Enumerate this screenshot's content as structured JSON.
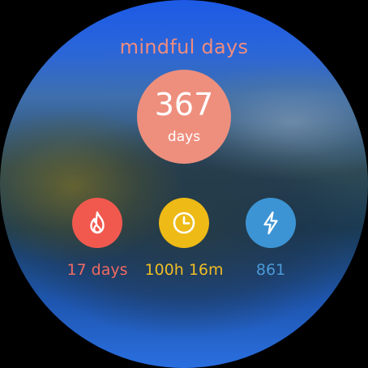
{
  "title": "mindful days",
  "total": {
    "value": "367",
    "unit": "days",
    "color": "#ee8f7e"
  },
  "stats": {
    "streak": {
      "icon": "flame-icon",
      "label": "17 days",
      "color": "#f1594f",
      "text_color": "#f06a62"
    },
    "time": {
      "icon": "clock-icon",
      "label": "100h 16m",
      "color": "#eeba16",
      "text_color": "#efbd24"
    },
    "energy": {
      "icon": "lightning-bolt-icon",
      "label": "861",
      "color": "#3d94d4",
      "text_color": "#4b9ad8"
    }
  }
}
